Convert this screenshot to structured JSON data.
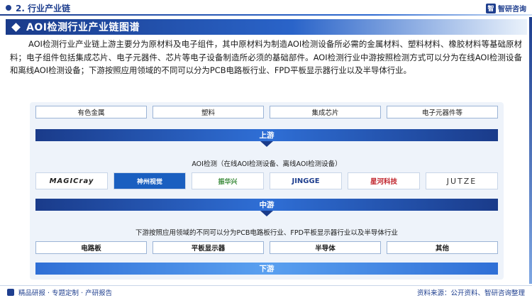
{
  "header": {
    "section": "2. 行业产业链",
    "brand": "智研咨询",
    "brand_mark": "智"
  },
  "title": "AOI检测行业产业链图谱",
  "paragraph": "AOI检测行业产业链上游主要分为原材料及电子组件，其中原材料为制造AOI检测设备所必需的金属材料、塑料材料、橡胶材料等基础原材料；电子组件包括集成芯片、电子元器件、芯片等电子设备制造所必须的基础部件。AOI检测行业中游按照检测方式可以分为在线AOI检测设备和离线AOI检测设备；下游按照应用领域的不同可以分为PCB电路板行业、FPD平板显示器行业以及半导体行业。",
  "upstream": {
    "items": [
      "有色金属",
      "塑料",
      "集成芯片",
      "电子元器件等"
    ],
    "label": "上游"
  },
  "midstream": {
    "subtitle": "AOI检测（在线AOI检测设备、离线AOI检测设备）",
    "logos": [
      {
        "text": "MAGICray",
        "color": "#222222"
      },
      {
        "text": "神州视觉",
        "color": "#1a5fc0"
      },
      {
        "text": "振华兴",
        "color": "#3a8a3a"
      },
      {
        "text": "JINGGE",
        "color": "#1f3f8f"
      },
      {
        "text": "星河科技",
        "color": "#c0262e"
      },
      {
        "text": "JUTZE",
        "color": "#333333"
      }
    ],
    "label": "中游"
  },
  "downstream": {
    "subtitle": "下游按照应用领域的不同可以分为PCB电路板行业、FPD平板显示器行业以及半导体行业",
    "items": [
      "电路板",
      "平板显示器",
      "半导体",
      "其他"
    ],
    "label": "下游"
  },
  "footer": {
    "left": "精品研报 · 专题定制 · 产研报告",
    "source": "资料来源：公开资料、智研咨询整理"
  },
  "colors": {
    "primary": "#1f3f8f",
    "accent": "#2f6fd6",
    "panel": "#eef3fa"
  }
}
